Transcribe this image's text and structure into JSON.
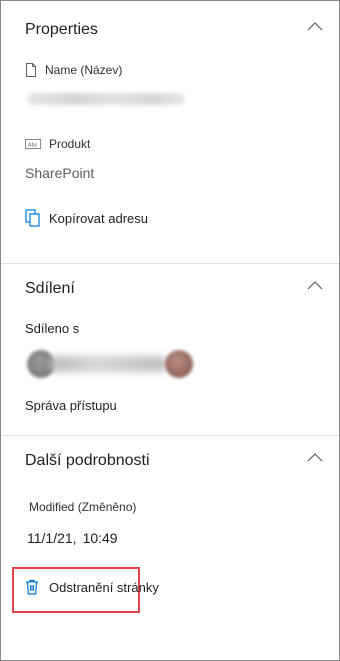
{
  "properties": {
    "title": "Properties",
    "name_label": "Name (Název)",
    "product_label": "Produkt",
    "product_value": "SharePoint",
    "copy_address": "Kopírovat adresu"
  },
  "sharing": {
    "title": "Sdílení",
    "shared_with": "Sdíleno s",
    "manage_access": "Správa přístupu"
  },
  "details": {
    "title": "Další podrobnosti",
    "modified_label": "Modified (Změněno)",
    "modified_date": "11/1/21,",
    "modified_time": "10:49"
  },
  "actions": {
    "delete_page": "Odstranění stránky"
  },
  "colors": {
    "accent": "#0078d4",
    "highlight_border": "#e5434b",
    "divider": "#e1dfdd"
  }
}
